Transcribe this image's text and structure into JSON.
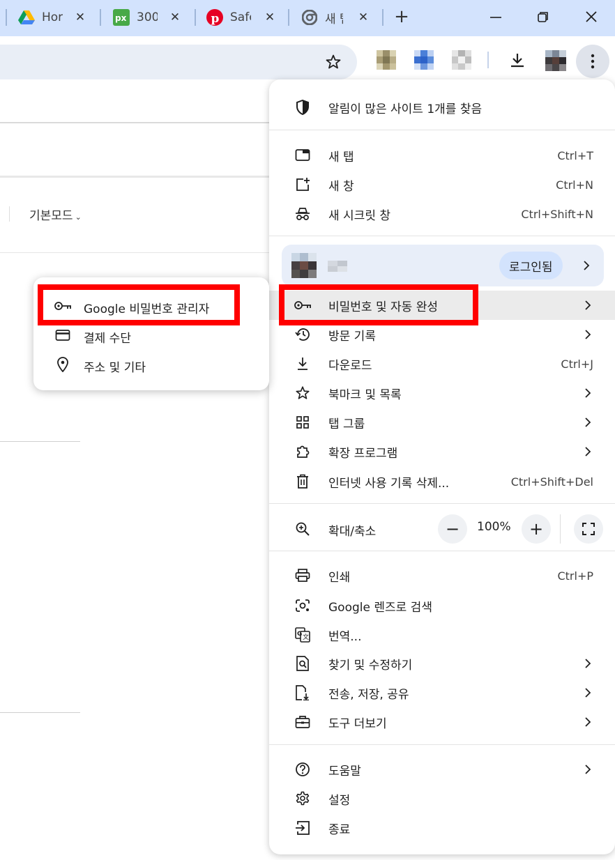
{
  "tabs": [
    {
      "title": "Hor",
      "icon": "google-drive-icon"
    },
    {
      "title": "300",
      "icon": "pixabay-icon"
    },
    {
      "title": "Safe",
      "icon": "pinterest-icon"
    },
    {
      "title": "새 탭",
      "icon": "chrome-icon"
    }
  ],
  "page": {
    "view_mode": "기본모드"
  },
  "menu": {
    "notifications": "알림이 많은 사이트 1개를 찾음",
    "new_tab": {
      "label": "새 탭",
      "shortcut": "Ctrl+T"
    },
    "new_window": {
      "label": "새 창",
      "shortcut": "Ctrl+N"
    },
    "incognito": {
      "label": "새 시크릿 창",
      "shortcut": "Ctrl+Shift+N"
    },
    "profile": {
      "signin": "로그인됨"
    },
    "passwords": {
      "label": "비밀번호 및 자동 완성"
    },
    "history": {
      "label": "방문 기록"
    },
    "downloads": {
      "label": "다운로드",
      "shortcut": "Ctrl+J"
    },
    "bookmarks": {
      "label": "북마크 및 목록"
    },
    "tab_groups": {
      "label": "탭 그룹"
    },
    "extensions": {
      "label": "확장 프로그램"
    },
    "clear_data": {
      "label": "인터넷 사용 기록 삭제...",
      "shortcut": "Ctrl+Shift+Del"
    },
    "zoom": {
      "label": "확대/축소",
      "minus": "−",
      "value": "100%",
      "plus": "+"
    },
    "print": {
      "label": "인쇄",
      "shortcut": "Ctrl+P"
    },
    "lens": {
      "label": "Google 렌즈로 검색"
    },
    "translate": {
      "label": "번역..."
    },
    "find": {
      "label": "찾기 및 수정하기"
    },
    "cast": {
      "label": "전송, 저장, 공유"
    },
    "more_tools": {
      "label": "도구 더보기"
    },
    "help": {
      "label": "도움말"
    },
    "settings": {
      "label": "설정"
    },
    "exit": {
      "label": "종료"
    }
  },
  "submenu": {
    "password_manager": "Google 비밀번호 관리자",
    "payment_methods": "결제 수단",
    "addresses": "주소 및 기타"
  },
  "colors": {
    "tabstrip_bg": "#d3e3fd",
    "omnibox_bg": "#e9eef6",
    "annotation_red": "#ff0000",
    "signin_chip": "#d3e3fd"
  }
}
